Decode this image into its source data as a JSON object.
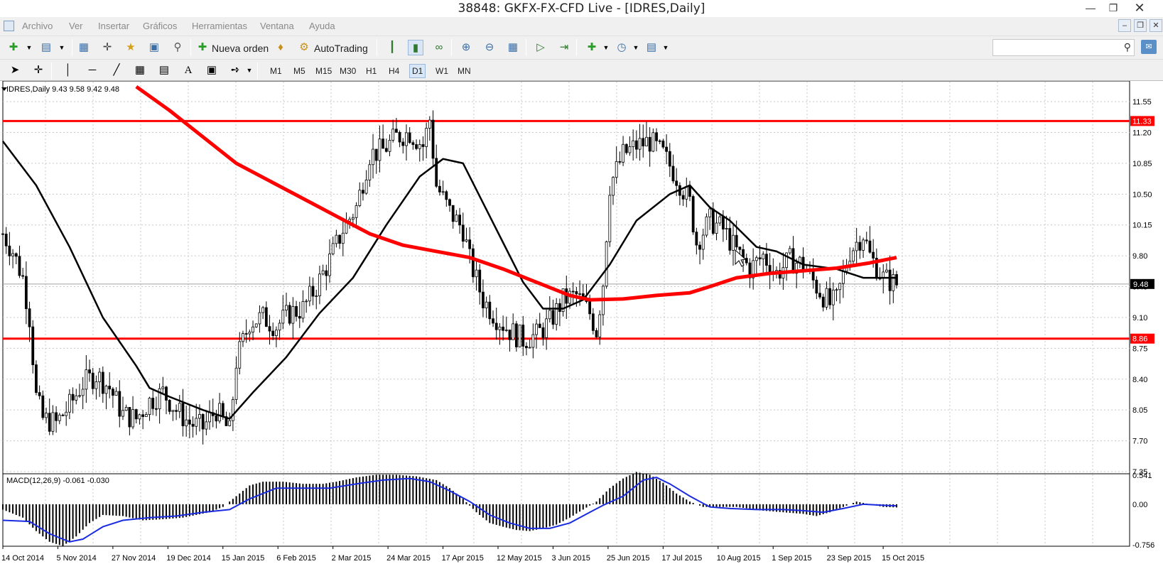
{
  "window": {
    "title": "38848: GKFX-FX-CFD Live - [IDRES,Daily]"
  },
  "menu": [
    "Archivo",
    "Ver",
    "Insertar",
    "Gráficos",
    "Herramientas",
    "Ventana",
    "Ayuda"
  ],
  "toolbar": {
    "new_order_label": "Nueva orden",
    "autotrading_label": "AutoTrading",
    "search_value": ""
  },
  "timeframes": [
    "M1",
    "M5",
    "M15",
    "M30",
    "H1",
    "H4",
    "D1",
    "W1",
    "MN"
  ],
  "active_timeframe": "D1",
  "chart_data": {
    "type": "candlestick",
    "header": "IDRES,Daily  9.43 9.58 9.42 9.48",
    "price_ticks": [
      "11.55",
      "11.20",
      "10.85",
      "10.50",
      "10.15",
      "9.80",
      "9.45",
      "9.10",
      "8.75",
      "8.40",
      "8.05",
      "7.70",
      "7.35"
    ],
    "price_range": [
      7.35,
      11.72
    ],
    "current_price_label": "9.48",
    "horizontal_lines": [
      {
        "price": 11.33,
        "label": "11.33",
        "color": "#ff0000"
      },
      {
        "price": 8.86,
        "label": "8.86",
        "color": "#ff0000"
      }
    ],
    "date_labels": [
      "14 Oct 2014",
      "5 Nov 2014",
      "27 Nov 2014",
      "19 Dec 2014",
      "15 Jan 2015",
      "6 Feb 2015",
      "2 Mar 2015",
      "24 Mar 2015",
      "17 Apr 2015",
      "12 May 2015",
      "3 Jun 2015",
      "25 Jun 2015",
      "17 Jul 2015",
      "10 Aug 2015",
      "1 Sep 2015",
      "23 Sep 2015",
      "15 Oct 2015"
    ],
    "close_path": [
      [
        0,
        10.05
      ],
      [
        3,
        9.85
      ],
      [
        6,
        9.55
      ],
      [
        8,
        9.1
      ],
      [
        10,
        8.2
      ],
      [
        12,
        7.95
      ],
      [
        16,
        7.9
      ],
      [
        20,
        8.1
      ],
      [
        24,
        8.35
      ],
      [
        28,
        8.45
      ],
      [
        32,
        8.3
      ],
      [
        36,
        8.0
      ],
      [
        40,
        7.95
      ],
      [
        44,
        8.15
      ],
      [
        48,
        8.25
      ],
      [
        52,
        8.05
      ],
      [
        56,
        7.9
      ],
      [
        60,
        7.85
      ],
      [
        64,
        8.05
      ],
      [
        68,
        7.8
      ],
      [
        70,
        8.6
      ],
      [
        74,
        9.05
      ],
      [
        78,
        9.1
      ],
      [
        82,
        9.0
      ],
      [
        86,
        9.15
      ],
      [
        90,
        9.2
      ],
      [
        94,
        9.45
      ],
      [
        98,
        9.75
      ],
      [
        102,
        10.1
      ],
      [
        106,
        10.35
      ],
      [
        110,
        10.95
      ],
      [
        114,
        11.0
      ],
      [
        118,
        11.15
      ],
      [
        122,
        11.2
      ],
      [
        126,
        11.05
      ],
      [
        128,
        11.35
      ],
      [
        130,
        10.6
      ],
      [
        134,
        10.3
      ],
      [
        138,
        10.1
      ],
      [
        140,
        9.75
      ],
      [
        144,
        9.3
      ],
      [
        148,
        9.1
      ],
      [
        152,
        8.95
      ],
      [
        156,
        8.85
      ],
      [
        160,
        8.9
      ],
      [
        164,
        9.05
      ],
      [
        168,
        9.3
      ],
      [
        172,
        9.35
      ],
      [
        176,
        9.15
      ],
      [
        178,
        8.95
      ],
      [
        180,
        9.5
      ],
      [
        182,
        10.6
      ],
      [
        186,
        10.95
      ],
      [
        190,
        11.05
      ],
      [
        194,
        11.1
      ],
      [
        198,
        10.95
      ],
      [
        202,
        10.7
      ],
      [
        206,
        10.4
      ],
      [
        208,
        9.95
      ],
      [
        212,
        10.2
      ],
      [
        216,
        10.1
      ],
      [
        220,
        9.85
      ],
      [
        224,
        9.65
      ],
      [
        228,
        9.8
      ],
      [
        232,
        9.6
      ],
      [
        236,
        9.75
      ],
      [
        240,
        9.7
      ],
      [
        244,
        9.45
      ],
      [
        248,
        9.25
      ],
      [
        250,
        9.3
      ],
      [
        254,
        9.85
      ],
      [
        258,
        10.05
      ],
      [
        260,
        9.8
      ],
      [
        264,
        9.55
      ],
      [
        268,
        9.48
      ]
    ],
    "indicators": [
      {
        "name": "MA black",
        "color": "#000000",
        "values": [
          [
            0,
            11.1
          ],
          [
            10,
            10.6
          ],
          [
            20,
            9.9
          ],
          [
            30,
            9.1
          ],
          [
            40,
            8.55
          ],
          [
            44,
            8.3
          ],
          [
            50,
            8.2
          ],
          [
            60,
            8.05
          ],
          [
            68,
            7.95
          ],
          [
            75,
            8.25
          ],
          [
            85,
            8.65
          ],
          [
            95,
            9.15
          ],
          [
            105,
            9.55
          ],
          [
            115,
            10.15
          ],
          [
            125,
            10.7
          ],
          [
            132,
            10.9
          ],
          [
            138,
            10.85
          ],
          [
            144,
            10.4
          ],
          [
            150,
            9.95
          ],
          [
            156,
            9.5
          ],
          [
            162,
            9.2
          ],
          [
            168,
            9.2
          ],
          [
            174,
            9.3
          ],
          [
            182,
            9.7
          ],
          [
            190,
            10.2
          ],
          [
            200,
            10.5
          ],
          [
            206,
            10.6
          ],
          [
            212,
            10.35
          ],
          [
            218,
            10.2
          ],
          [
            226,
            9.9
          ],
          [
            232,
            9.85
          ],
          [
            240,
            9.7
          ],
          [
            250,
            9.65
          ],
          [
            258,
            9.55
          ],
          [
            268,
            9.55
          ]
        ]
      },
      {
        "name": "MA red",
        "color": "#ff0000",
        "values": [
          [
            40,
            11.72
          ],
          [
            50,
            11.45
          ],
          [
            60,
            11.15
          ],
          [
            70,
            10.85
          ],
          [
            80,
            10.65
          ],
          [
            90,
            10.45
          ],
          [
            100,
            10.25
          ],
          [
            110,
            10.05
          ],
          [
            120,
            9.92
          ],
          [
            130,
            9.85
          ],
          [
            140,
            9.78
          ],
          [
            150,
            9.65
          ],
          [
            160,
            9.5
          ],
          [
            170,
            9.35
          ],
          [
            176,
            9.3
          ],
          [
            186,
            9.31
          ],
          [
            196,
            9.35
          ],
          [
            206,
            9.38
          ],
          [
            212,
            9.45
          ],
          [
            220,
            9.55
          ],
          [
            230,
            9.6
          ],
          [
            240,
            9.63
          ],
          [
            250,
            9.66
          ],
          [
            260,
            9.72
          ],
          [
            268,
            9.78
          ]
        ]
      }
    ],
    "macd": {
      "label": "MACD(12,26,9) -0.061 -0.030",
      "ticks": [
        "0.541",
        "0.00",
        "-0.756"
      ],
      "range": [
        -0.756,
        0.541
      ],
      "histogram": [
        [
          0,
          -0.1
        ],
        [
          6,
          -0.25
        ],
        [
          10,
          -0.5
        ],
        [
          14,
          -0.7
        ],
        [
          18,
          -0.78
        ],
        [
          22,
          -0.6
        ],
        [
          26,
          -0.35
        ],
        [
          30,
          -0.2
        ],
        [
          36,
          -0.22
        ],
        [
          42,
          -0.3
        ],
        [
          48,
          -0.28
        ],
        [
          54,
          -0.25
        ],
        [
          58,
          -0.2
        ],
        [
          62,
          -0.15
        ],
        [
          66,
          -0.05
        ],
        [
          70,
          0.15
        ],
        [
          74,
          0.35
        ],
        [
          78,
          0.42
        ],
        [
          84,
          0.42
        ],
        [
          90,
          0.38
        ],
        [
          96,
          0.38
        ],
        [
          100,
          0.42
        ],
        [
          106,
          0.5
        ],
        [
          112,
          0.55
        ],
        [
          118,
          0.55
        ],
        [
          124,
          0.52
        ],
        [
          130,
          0.45
        ],
        [
          134,
          0.3
        ],
        [
          138,
          0.1
        ],
        [
          142,
          -0.15
        ],
        [
          146,
          -0.35
        ],
        [
          150,
          -0.42
        ],
        [
          154,
          -0.48
        ],
        [
          158,
          -0.5
        ],
        [
          162,
          -0.45
        ],
        [
          166,
          -0.38
        ],
        [
          170,
          -0.25
        ],
        [
          174,
          -0.1
        ],
        [
          178,
          0.05
        ],
        [
          182,
          0.3
        ],
        [
          186,
          0.48
        ],
        [
          190,
          0.6
        ],
        [
          194,
          0.55
        ],
        [
          198,
          0.4
        ],
        [
          202,
          0.2
        ],
        [
          206,
          0.05
        ],
        [
          210,
          -0.05
        ],
        [
          214,
          -0.05
        ],
        [
          220,
          -0.05
        ],
        [
          228,
          -0.12
        ],
        [
          234,
          -0.15
        ],
        [
          240,
          -0.18
        ],
        [
          244,
          -0.22
        ],
        [
          248,
          -0.15
        ],
        [
          252,
          -0.05
        ],
        [
          256,
          0.05
        ],
        [
          260,
          0.0
        ],
        [
          264,
          -0.05
        ],
        [
          268,
          -0.06
        ]
      ],
      "signal": [
        [
          0,
          -0.3
        ],
        [
          8,
          -0.32
        ],
        [
          14,
          -0.55
        ],
        [
          20,
          -0.7
        ],
        [
          24,
          -0.65
        ],
        [
          30,
          -0.42
        ],
        [
          36,
          -0.3
        ],
        [
          44,
          -0.25
        ],
        [
          52,
          -0.22
        ],
        [
          60,
          -0.15
        ],
        [
          68,
          -0.1
        ],
        [
          74,
          0.1
        ],
        [
          82,
          0.3
        ],
        [
          90,
          0.3
        ],
        [
          98,
          0.3
        ],
        [
          106,
          0.38
        ],
        [
          114,
          0.45
        ],
        [
          122,
          0.48
        ],
        [
          128,
          0.42
        ],
        [
          134,
          0.25
        ],
        [
          140,
          0.05
        ],
        [
          146,
          -0.2
        ],
        [
          152,
          -0.35
        ],
        [
          158,
          -0.45
        ],
        [
          164,
          -0.45
        ],
        [
          170,
          -0.35
        ],
        [
          176,
          -0.15
        ],
        [
          180,
          -0.02
        ],
        [
          186,
          0.15
        ],
        [
          192,
          0.45
        ],
        [
          196,
          0.5
        ],
        [
          200,
          0.38
        ],
        [
          206,
          0.15
        ],
        [
          212,
          -0.05
        ],
        [
          218,
          -0.08
        ],
        [
          226,
          -0.1
        ],
        [
          234,
          -0.1
        ],
        [
          240,
          -0.12
        ],
        [
          246,
          -0.15
        ],
        [
          252,
          -0.08
        ],
        [
          258,
          0.0
        ],
        [
          264,
          -0.02
        ],
        [
          268,
          -0.03
        ]
      ]
    }
  }
}
